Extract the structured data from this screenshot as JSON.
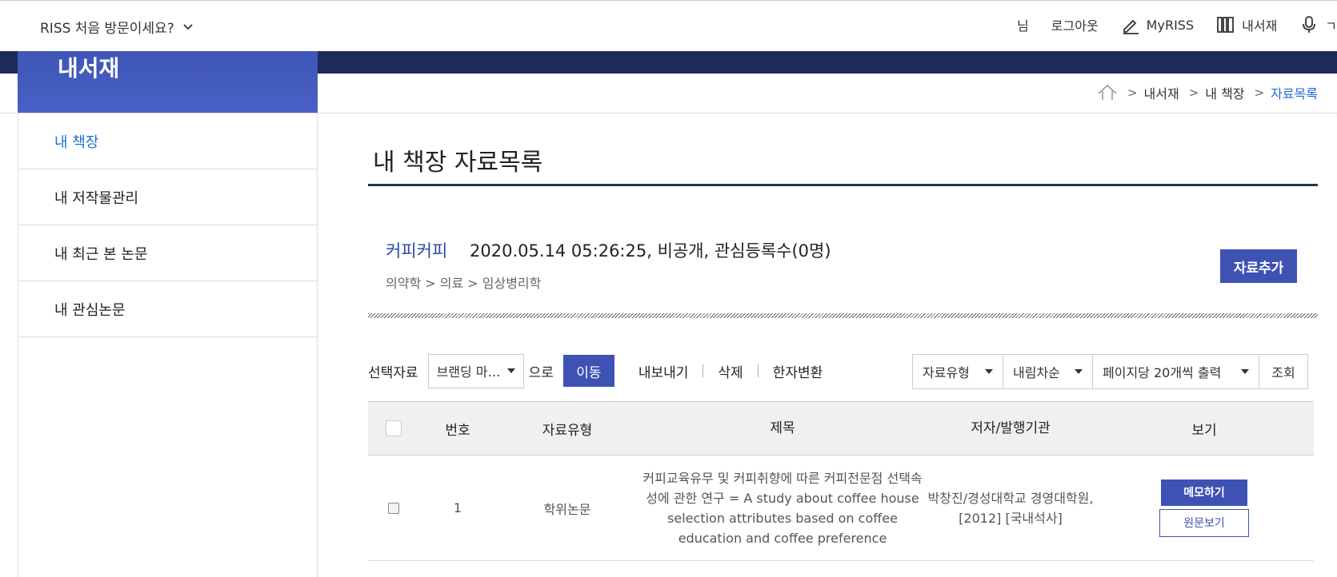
{
  "header": {
    "first_visit": "RISS 처음 방문이세요?",
    "user_suffix": "님",
    "logout": "로그아웃",
    "myriss": "MyRISS",
    "my_library": "내서재",
    "voice_partial": "ㄱ"
  },
  "section_title": "내서재",
  "breadcrumb": [
    "내서재",
    "내 책장",
    "자료목록"
  ],
  "sidebar": {
    "items": [
      {
        "label": "내 책장",
        "active": true
      },
      {
        "label": "내 저작물관리",
        "active": false
      },
      {
        "label": "내 최근 본 논문",
        "active": false
      },
      {
        "label": "내 관심논문",
        "active": false
      }
    ]
  },
  "page_title": "내 책장 자료목록",
  "shelf": {
    "name": "커피커피",
    "meta": "2020.05.14 05:26:25, 비공개, 관심등록수(0명)",
    "category": "의약학 > 의료 > 임상병리학",
    "add_label": "자료추가"
  },
  "toolbar": {
    "selected_label": "선택자료",
    "target_select": "브랜딩 마…",
    "euro": "으로",
    "move": "이동",
    "export": "내보내기",
    "delete": "삭제",
    "hanja": "한자변환"
  },
  "filters": {
    "type": "자료유형",
    "order": "내림차순",
    "per_page": "페이지당 20개씩 출력",
    "search": "조회"
  },
  "table": {
    "headers": [
      "번호",
      "자료유형",
      "제목",
      "저자/발행기관",
      "보기"
    ],
    "rows": [
      {
        "no": "1",
        "type": "학위논문",
        "title": "커피교육유무 및 커피취향에 따른 커피전문점 선택속성에 관한 연구 = A study about coffee house selection attributes based on coffee education and coffee preference",
        "author": "박창진/경성대학교 경영대학원,[2012] [국내석사]",
        "memo": "메모하기",
        "original": "원문보기"
      }
    ]
  },
  "colors": {
    "navy": "#1e2b5a",
    "accent_blue": "#3e52b4",
    "link_blue": "#1f6fd1"
  }
}
